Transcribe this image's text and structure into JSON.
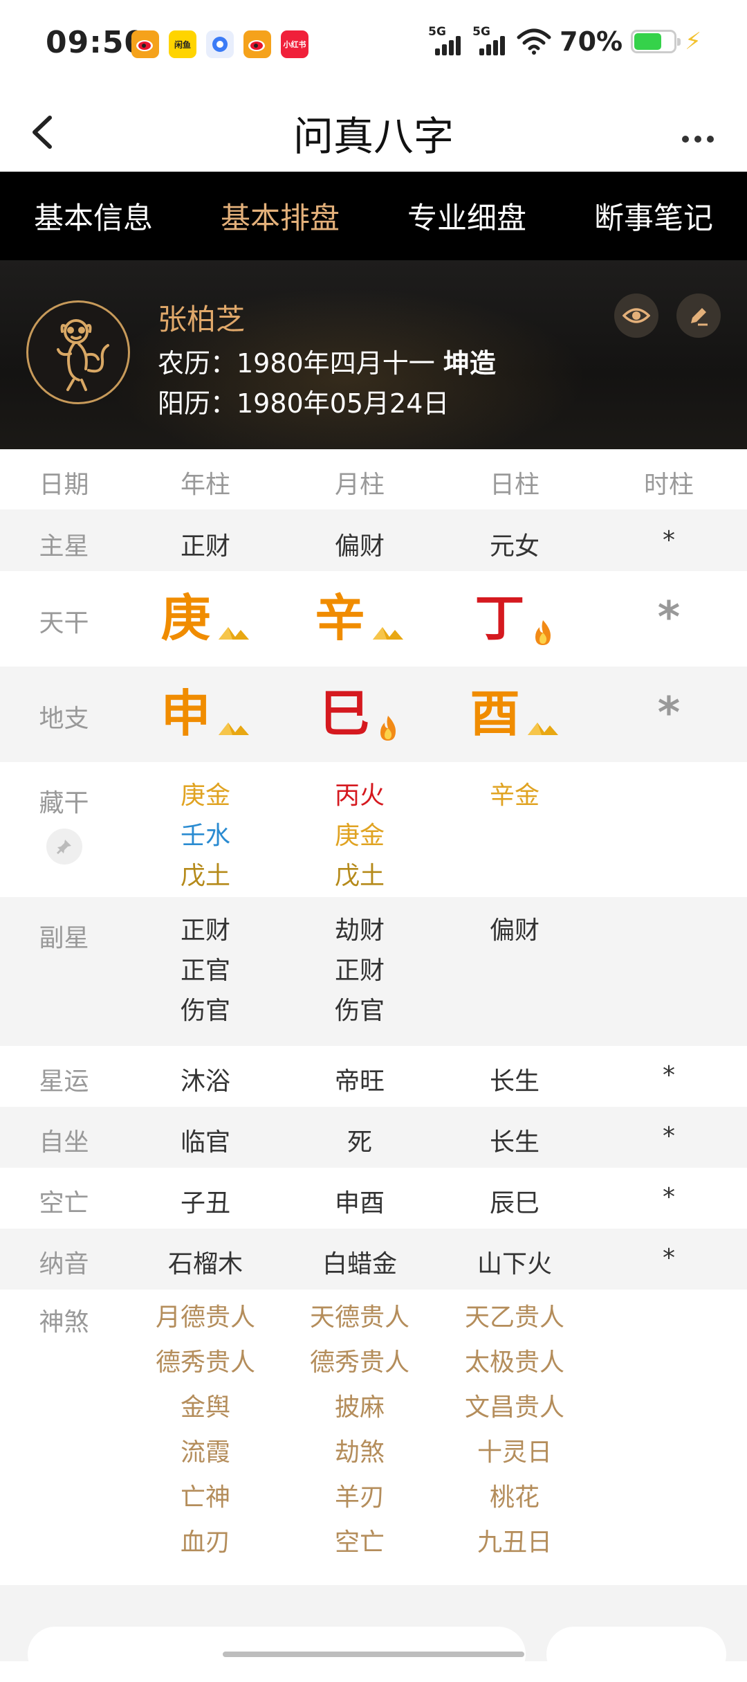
{
  "status_bar": {
    "time": "09:50",
    "apps": [
      {
        "name": "weibo",
        "color": "#f5a21b"
      },
      {
        "name": "xianyu",
        "color": "#ffd400",
        "text": "闲鱼"
      },
      {
        "name": "browser",
        "color": "#e8eefc"
      },
      {
        "name": "weibo",
        "color": "#f5a21b"
      },
      {
        "name": "xiaohongshu",
        "color": "#f0203a",
        "text": "小红书"
      }
    ],
    "signal1": "5G",
    "signal2": "5G",
    "battery": "70%",
    "battery_level": 0.7
  },
  "titlebar": {
    "title": "问真八字"
  },
  "tabs": [
    {
      "label": "基本信息",
      "active": false
    },
    {
      "label": "基本排盘",
      "active": true
    },
    {
      "label": "专业细盘",
      "active": false
    },
    {
      "label": "断事笔记",
      "active": false
    }
  ],
  "profile": {
    "name": "张柏芝",
    "lunar_label": "农历：1980年四月十一",
    "gender_tag": "坤造",
    "solar_label": "阳历：1980年05月24日"
  },
  "table": {
    "header": {
      "label": "日期",
      "cols": [
        "年柱",
        "月柱",
        "日柱",
        "时柱"
      ]
    },
    "main_star": {
      "label": "主星",
      "cols": [
        "正财",
        "偏财",
        "元女",
        "*"
      ]
    },
    "tiangan": {
      "label": "天干",
      "cols": [
        "庚",
        "辛",
        "丁",
        "*"
      ]
    },
    "dizhi": {
      "label": "地支",
      "cols": [
        "申",
        "巳",
        "酉",
        "*"
      ]
    },
    "canggan": {
      "label": "藏干",
      "cols": [
        [
          "庚金",
          "壬水",
          "戊土"
        ],
        [
          "丙火",
          "庚金",
          "戊土"
        ],
        [
          "辛金"
        ]
      ]
    },
    "fuxing": {
      "label": "副星",
      "cols": [
        [
          "正财",
          "正官",
          "伤官"
        ],
        [
          "劫财",
          "正财",
          "伤官"
        ],
        [
          "偏财"
        ]
      ]
    },
    "xingyun": {
      "label": "星运",
      "cols": [
        "沐浴",
        "帝旺",
        "长生",
        "*"
      ]
    },
    "zizuo": {
      "label": "自坐",
      "cols": [
        "临官",
        "死",
        "长生",
        "*"
      ]
    },
    "kongwang": {
      "label": "空亡",
      "cols": [
        "子丑",
        "申酉",
        "辰巳",
        "*"
      ]
    },
    "nayin": {
      "label": "纳音",
      "cols": [
        "石榴木",
        "白蜡金",
        "山下火",
        "*"
      ]
    },
    "shensha": {
      "label": "神煞",
      "cols": [
        [
          "月德贵人",
          "德秀贵人",
          "金舆",
          "流霞",
          "亡神",
          "血刃"
        ],
        [
          "天德贵人",
          "德秀贵人",
          "披麻",
          "劫煞",
          "羊刃",
          "空亡"
        ],
        [
          "天乙贵人",
          "太极贵人",
          "文昌贵人",
          "十灵日",
          "桃花",
          "九丑日"
        ]
      ]
    }
  },
  "colors": {
    "accent_gold": "#e3b07a",
    "metal_orange": "#f08c00",
    "fire_red": "#d5191f",
    "water_blue": "#2a8bd1",
    "shensha_tan": "#b48d5b"
  }
}
